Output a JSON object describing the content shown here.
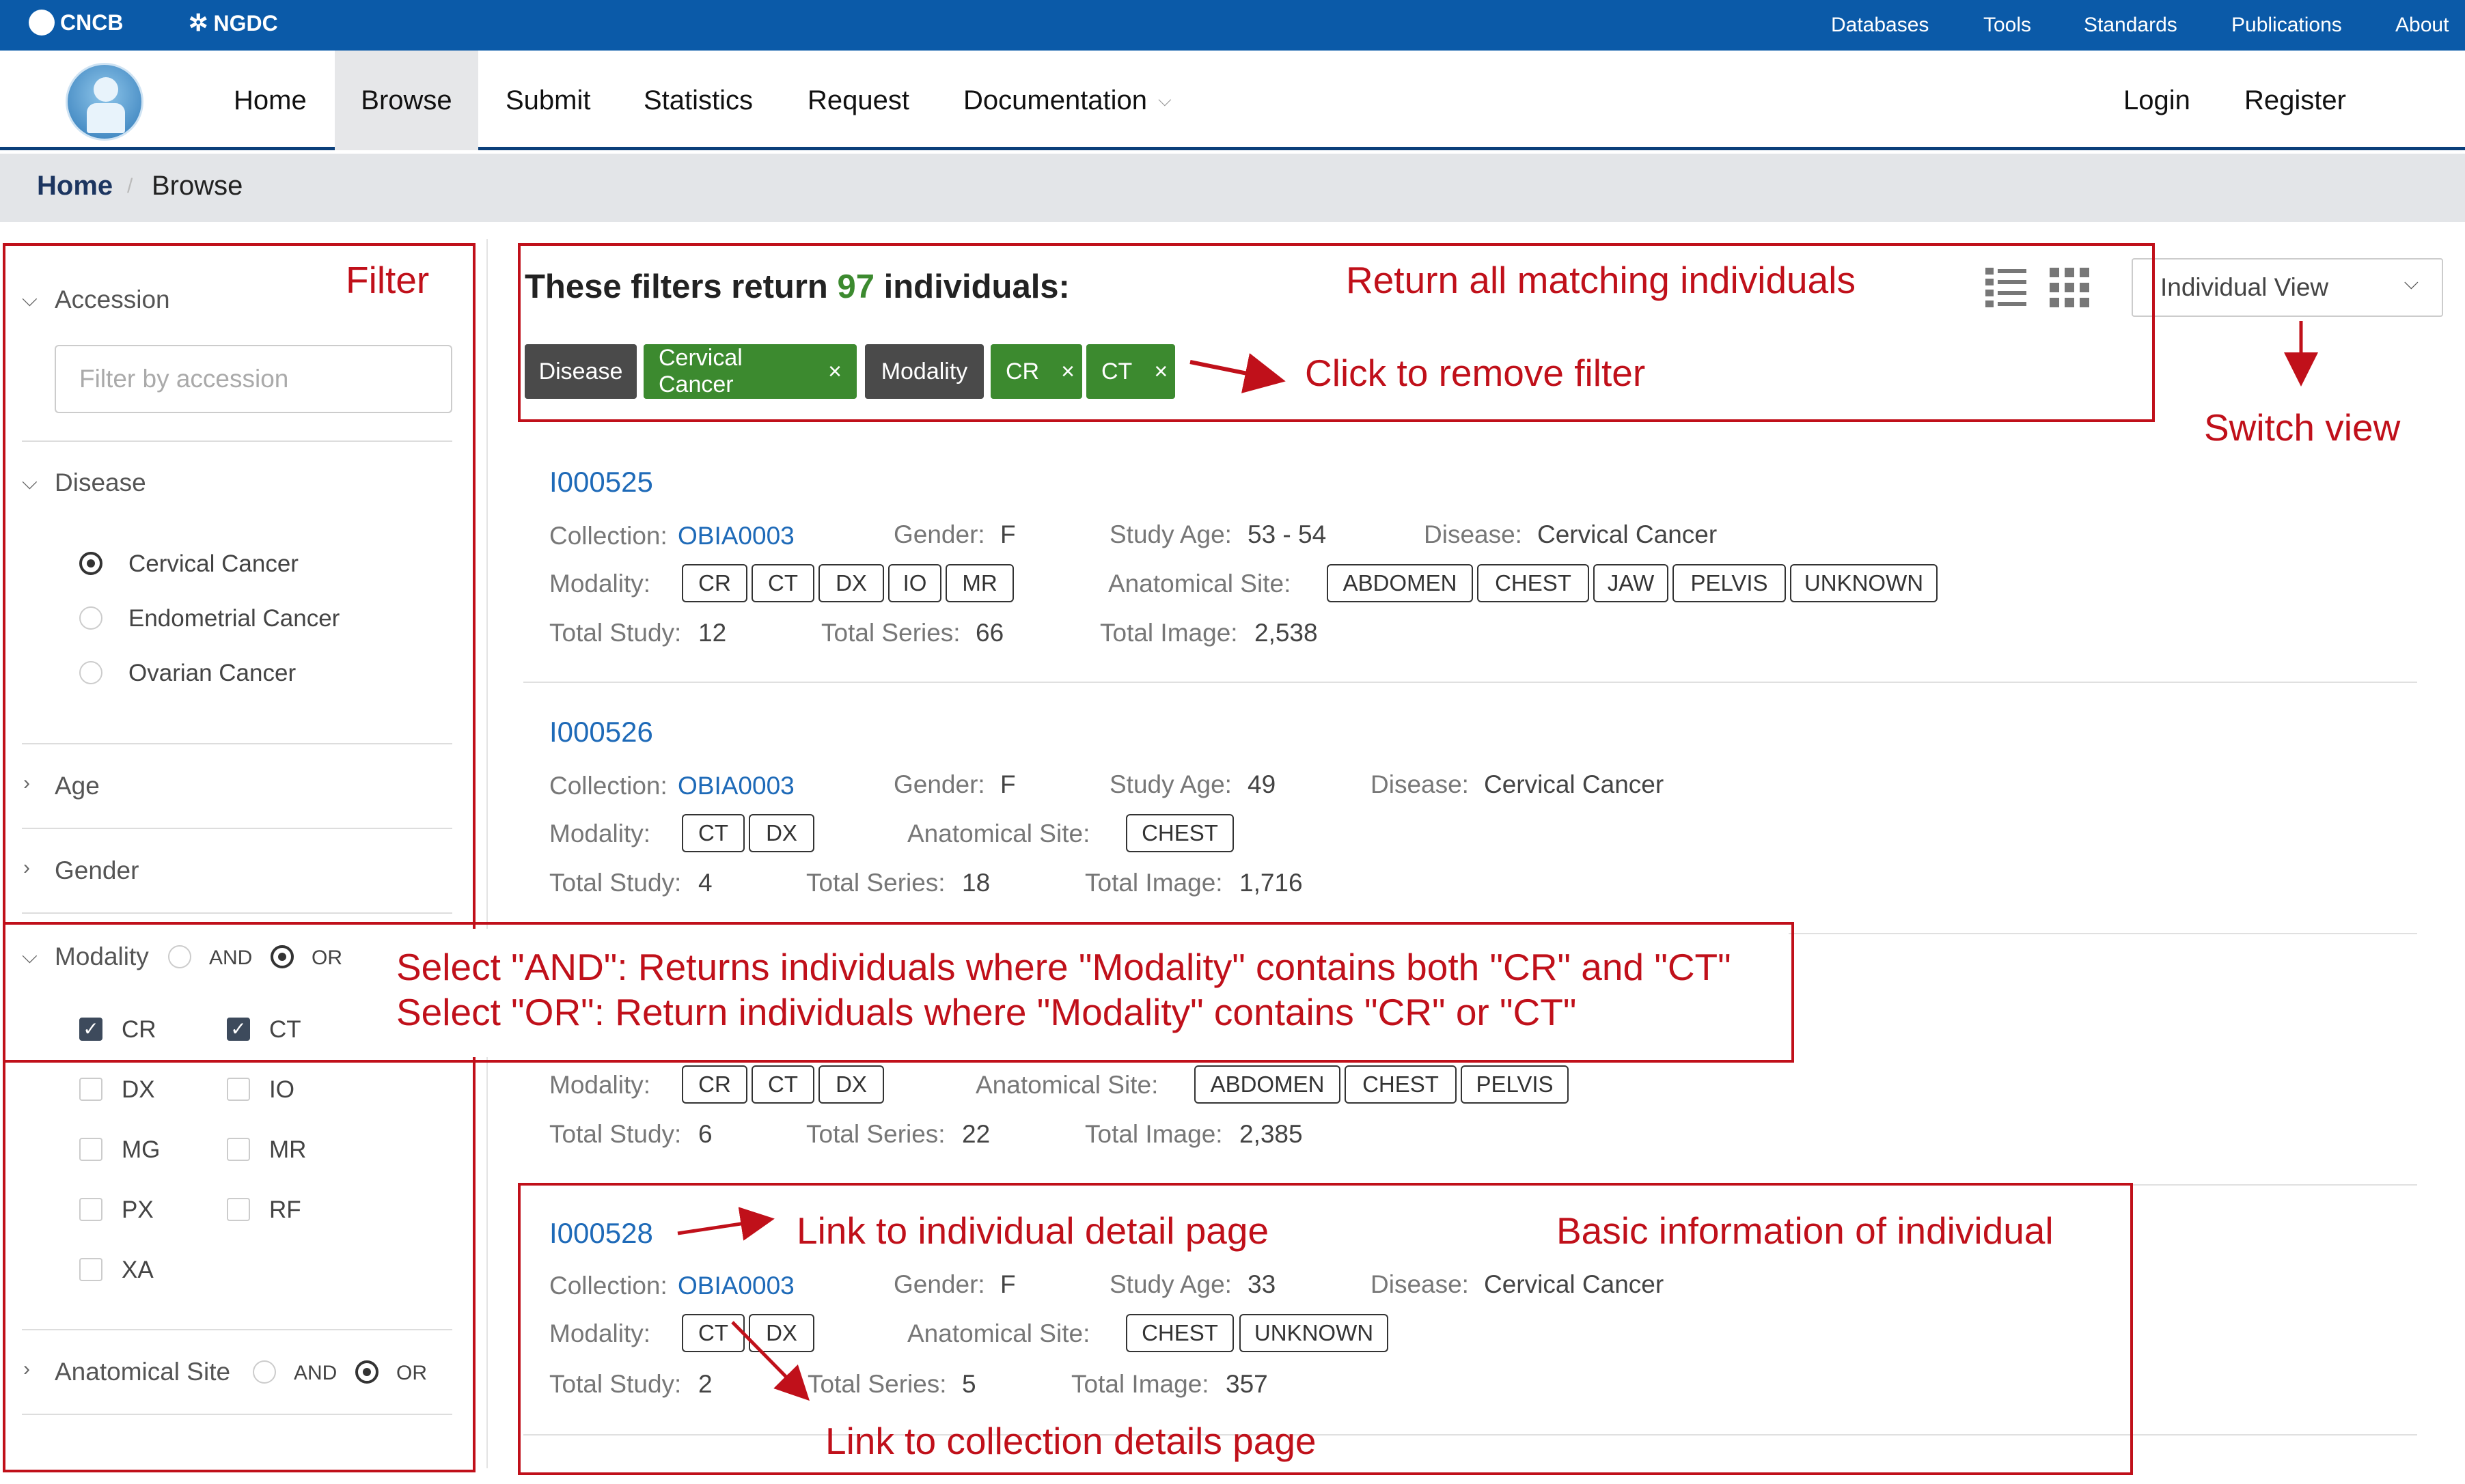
{
  "topbar": {
    "brands": [
      "CNCB",
      "NGDC"
    ],
    "links": [
      "Databases",
      "Tools",
      "Standards",
      "Publications",
      "About"
    ]
  },
  "nav": {
    "items": [
      "Home",
      "Browse",
      "Submit",
      "Statistics",
      "Request",
      "Documentation"
    ],
    "active": "Browse",
    "login": "Login",
    "register": "Register"
  },
  "breadcrumb": {
    "home": "Home",
    "separator": "/",
    "current": "Browse"
  },
  "sidebar": {
    "accession": {
      "label": "Accession",
      "placeholder": "Filter by accession"
    },
    "disease": {
      "label": "Disease",
      "options": [
        {
          "label": "Cervical Cancer",
          "selected": true
        },
        {
          "label": "Endometrial Cancer",
          "selected": false
        },
        {
          "label": "Ovarian Cancer",
          "selected": false
        }
      ]
    },
    "age": {
      "label": "Age"
    },
    "gender": {
      "label": "Gender"
    },
    "modality": {
      "label": "Modality",
      "and_label": "AND",
      "or_label": "OR",
      "mode": "OR",
      "options": [
        {
          "label": "CR",
          "checked": true
        },
        {
          "label": "CT",
          "checked": true
        },
        {
          "label": "DX",
          "checked": false
        },
        {
          "label": "IO",
          "checked": false
        },
        {
          "label": "MG",
          "checked": false
        },
        {
          "label": "MR",
          "checked": false
        },
        {
          "label": "PX",
          "checked": false
        },
        {
          "label": "RF",
          "checked": false
        },
        {
          "label": "XA",
          "checked": false
        }
      ]
    },
    "anatomical": {
      "label": "Anatomical Site",
      "and_label": "AND",
      "or_label": "OR",
      "mode": "OR"
    }
  },
  "results": {
    "prefix": "These filters return",
    "count": "97",
    "suffix": "individuals:",
    "filters": [
      {
        "label": "Disease",
        "style": "dark",
        "removable": false
      },
      {
        "label": "Cervical Cancer",
        "style": "green",
        "removable": true
      },
      {
        "label": "Modality",
        "style": "dark",
        "removable": false
      },
      {
        "label": "CR",
        "style": "green",
        "removable": true
      },
      {
        "label": "CT",
        "style": "green",
        "removable": true
      }
    ],
    "remove_glyph": "×",
    "view_select": "Individual View",
    "labels": {
      "collection": "Collection:",
      "gender": "Gender:",
      "study_age": "Study Age:",
      "disease": "Disease:",
      "modality": "Modality:",
      "anatomical_site": "Anatomical Site:",
      "total_study": "Total Study:",
      "total_series": "Total Series:",
      "total_image": "Total Image:"
    },
    "individuals": [
      {
        "id": "I000525",
        "collection": "OBIA0003",
        "gender": "F",
        "study_age": "53 - 54",
        "disease": "Cervical Cancer",
        "modality": [
          "CR",
          "CT",
          "DX",
          "IO",
          "MR"
        ],
        "anatomical_site": [
          "ABDOMEN",
          "CHEST",
          "JAW",
          "PELVIS",
          "UNKNOWN"
        ],
        "total_study": "12",
        "total_series": "66",
        "total_image": "2,538"
      },
      {
        "id": "I000526",
        "collection": "OBIA0003",
        "gender": "F",
        "study_age": "49",
        "disease": "Cervical Cancer",
        "modality": [
          "CT",
          "DX"
        ],
        "anatomical_site": [
          "CHEST"
        ],
        "total_study": "4",
        "total_series": "18",
        "total_image": "1,716"
      },
      {
        "id": "",
        "collection": "",
        "gender": "",
        "study_age": "",
        "disease": "",
        "modality": [
          "CR",
          "CT",
          "DX"
        ],
        "anatomical_site": [
          "ABDOMEN",
          "CHEST",
          "PELVIS"
        ],
        "total_study": "6",
        "total_series": "22",
        "total_image": "2,385"
      },
      {
        "id": "I000528",
        "collection": "OBIA0003",
        "gender": "F",
        "study_age": "33",
        "disease": "Cervical Cancer",
        "modality": [
          "CT",
          "DX"
        ],
        "anatomical_site": [
          "CHEST",
          "UNKNOWN"
        ],
        "total_study": "2",
        "total_series": "5",
        "total_image": "357"
      }
    ]
  },
  "annotations": {
    "filter": "Filter",
    "return_all": "Return all matching individuals",
    "remove_filter": "Click to remove filter",
    "switch_view": "Switch view",
    "and_or_line1": "Select \"AND\": Returns individuals where \"Modality\" contains both \"CR\" and \"CT\"",
    "and_or_line2": "Select \"OR\": Return individuals where \"Modality\" contains \"CR\" or \"CT\"",
    "detail_link": "Link to individual detail page",
    "basic_info": "Basic information of individual",
    "collection_link": "Link to collection details page"
  },
  "colors": {
    "topbar": "#0b5aa8",
    "accent_green": "#3c8a2f",
    "annotation_red": "#c0101a",
    "link_blue": "#1e6ab8"
  }
}
